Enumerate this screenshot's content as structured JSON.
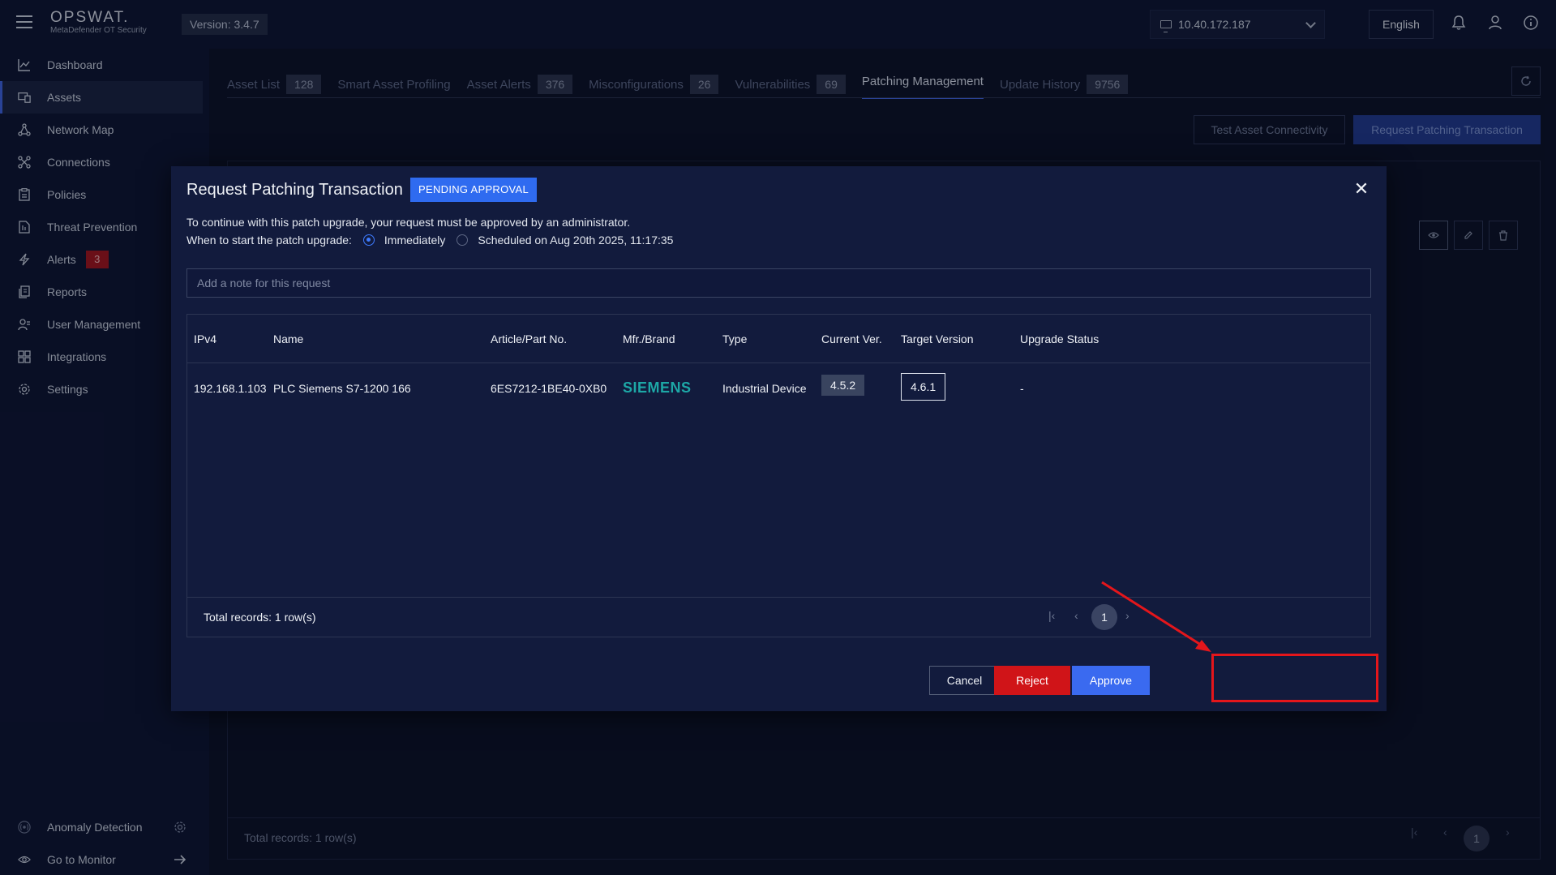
{
  "header": {
    "brand": "OPSWAT.",
    "product": "MetaDefender OT Security",
    "version": "Version: 3.4.7",
    "ip": "10.40.172.187",
    "language": "English"
  },
  "sidebar": {
    "items": [
      {
        "label": "Dashboard",
        "icon": "chart-line-icon"
      },
      {
        "label": "Assets",
        "icon": "assets-icon"
      },
      {
        "label": "Network Map",
        "icon": "network-icon"
      },
      {
        "label": "Connections",
        "icon": "connections-icon"
      },
      {
        "label": "Policies",
        "icon": "clipboard-icon"
      },
      {
        "label": "Threat Prevention",
        "icon": "shield-file-icon"
      },
      {
        "label": "Alerts",
        "icon": "lightning-icon",
        "badge": "3"
      },
      {
        "label": "Reports",
        "icon": "reports-icon"
      },
      {
        "label": "User Management",
        "icon": "users-icon"
      },
      {
        "label": "Integrations",
        "icon": "integrations-icon"
      },
      {
        "label": "Settings",
        "icon": "gear-icon"
      }
    ],
    "bottom": [
      {
        "label": "Anomaly Detection",
        "icon": "radar-icon"
      },
      {
        "label": "Go to Monitor",
        "icon": "eye-icon"
      }
    ]
  },
  "tabs": [
    {
      "label": "Asset List",
      "count": "128"
    },
    {
      "label": "Smart Asset Profiling",
      "count": ""
    },
    {
      "label": "Asset Alerts",
      "count": "376"
    },
    {
      "label": "Misconfigurations",
      "count": "26"
    },
    {
      "label": "Vulnerabilities",
      "count": "69"
    },
    {
      "label": "Patching Management",
      "count": ""
    },
    {
      "label": "Update History",
      "count": "9756"
    }
  ],
  "background": {
    "test_button": "Test Asset Connectivity",
    "request_button": "Request Patching Transaction",
    "total": "Total records: 1 row(s)",
    "page": "1"
  },
  "modal": {
    "title": "Request Patching Transaction",
    "status": "PENDING APPROVAL",
    "description": "To continue with this patch upgrade, your request must be approved by an administrator.",
    "when_label": "When to start the patch upgrade:",
    "option_immediately": "Immediately",
    "option_scheduled": "Scheduled on Aug 20th 2025, 11:17:35",
    "note_placeholder": "Add a note for this request",
    "columns": [
      "IPv4",
      "Name",
      "Article/Part No.",
      "Mfr./Brand",
      "Type",
      "Current Ver.",
      "Target Version",
      "Upgrade Status"
    ],
    "row": {
      "ipv4": "192.168.1.103",
      "name": "PLC Siemens S7-1200 166",
      "article": "6ES7212-1BE40-0XB0",
      "brand": "SIEMENS",
      "type": "Industrial Device",
      "current": "4.5.2",
      "target": "4.6.1",
      "status": "-"
    },
    "total": "Total records: 1 row(s)",
    "page": "1",
    "cancel": "Cancel",
    "reject": "Reject",
    "approve": "Approve"
  },
  "colors": {
    "accent": "#3a6af0",
    "reject": "#d01418",
    "highlight": "#e4161b"
  }
}
